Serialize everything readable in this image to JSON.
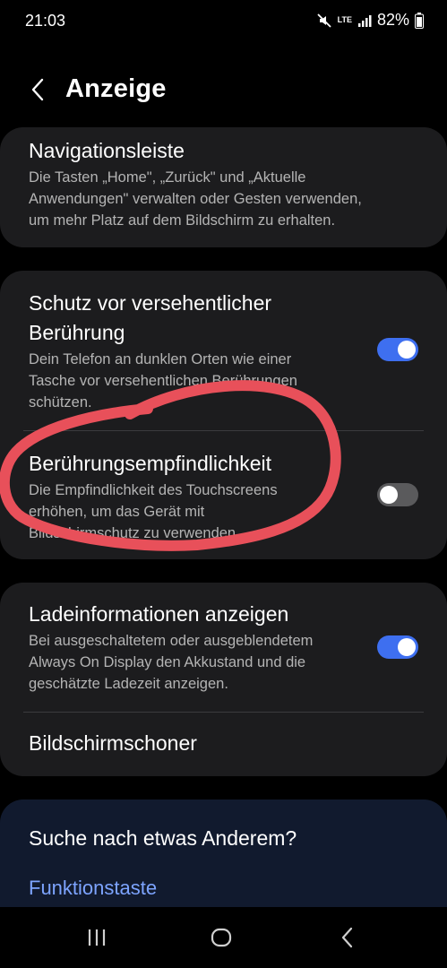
{
  "status_bar": {
    "time": "21:03",
    "network": "LTE",
    "battery": "82%",
    "icons": [
      "mute-icon",
      "lte-icon",
      "signal-icon",
      "battery-icon"
    ]
  },
  "header": {
    "title": "Anzeige"
  },
  "settings": {
    "navigation": {
      "title": "Navigationsleiste",
      "desc_line1": "Die Tasten „Home\", „Zurück\" und „Aktuelle",
      "desc_line2": "Anwendungen\" verwalten oder Gesten verwenden,",
      "desc_line3": "um mehr Platz auf dem Bildschirm zu erhalten."
    },
    "accidental_touch": {
      "title_line1": "Schutz vor versehentlicher",
      "title_line2": "Berührung",
      "desc_line1": "Dein Telefon an dunklen Orten wie einer",
      "desc_line2": "Tasche vor versehentlichen Berührungen",
      "desc_line3": "schützen.",
      "enabled": true
    },
    "touch_sensitivity": {
      "title": "Berührungsempfindlichkeit",
      "desc_line1": "Die Empfindlichkeit des Touchscreens",
      "desc_line2": "erhöhen, um das Gerät mit",
      "desc_line3": "Bildschirmschutz zu verwenden.",
      "enabled": false
    },
    "charging_info": {
      "title": "Ladeinformationen anzeigen",
      "desc_line1": "Bei ausgeschaltetem oder ausgeblendetem",
      "desc_line2": "Always On Display den Akkustand und die",
      "desc_line3": "geschätzte Ladezeit anzeigen.",
      "enabled": true
    },
    "screensaver": {
      "title": "Bildschirmschoner"
    }
  },
  "suggestions": {
    "title": "Suche nach etwas Anderem?",
    "link": "Funktionstaste"
  },
  "colors": {
    "accent": "#3e6ff0",
    "annotation": "#e8505a",
    "card": "#1c1c1e",
    "link": "#7da4ff"
  },
  "nav_bar": {
    "buttons": [
      "recents-icon",
      "home-icon",
      "back-icon"
    ]
  }
}
